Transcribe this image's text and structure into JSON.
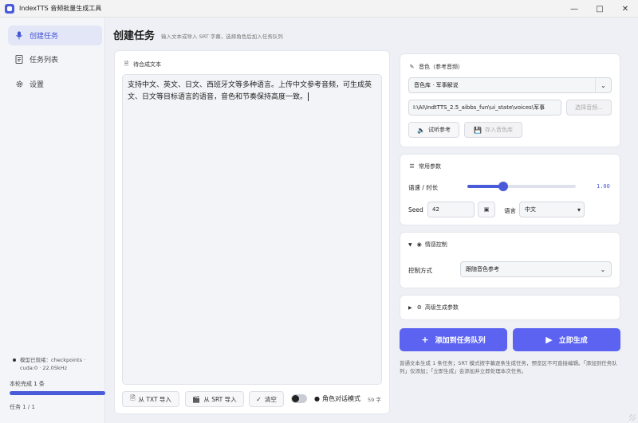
{
  "window": {
    "title": "IndexTTS 音频批量生成工具",
    "controls": [
      "minimize",
      "maximize",
      "close"
    ]
  },
  "sidebar": {
    "items": [
      {
        "label": "创建任务",
        "icon": "microphone-icon",
        "active": true
      },
      {
        "label": "任务列表",
        "icon": "list-icon",
        "active": false
      },
      {
        "label": "设置",
        "icon": "gear-icon",
        "active": false
      }
    ],
    "model_status": "模型已就绪：checkpoints · cuda:0 · 22.05kHz",
    "progress_label": "本轮完成 1 条",
    "progress_fraction": 1.0,
    "task_counter": "任务 1 / 1"
  },
  "header": {
    "title": "创建任务",
    "subtitle": "输入文本或导入 SRT 字幕，选择角色后加入任务队列"
  },
  "text_panel": {
    "title": "待合成文本",
    "content": "支持中文、英文、日文、西班牙文等多种语言。上传中文参考音频，可生成英文、日文等目标语言的语音，音色和节奏保持高度一致。",
    "import_txt_label": "从 TXT 导入",
    "import_srt_label": "从 SRT 导入",
    "clear_label": "清空",
    "role_dialog_label": "角色对话模式",
    "role_dialog_enabled": false,
    "char_count": "59 字"
  },
  "voice_panel": {
    "title": "音色（参考音频）",
    "voice_select": "音色库 · 军事解说",
    "ref_path": "I:\\AI\\IndtTTS_2.5_aibbs_fun\\ui_state\\voices\\军事",
    "choose_audio_label": "选择音频...",
    "preview_label": "试听参考",
    "save_label": "存入音色库"
  },
  "params_panel": {
    "title": "常用参数",
    "speed_label": "语速 / 时长",
    "speed_value": "1.00",
    "speed_slider_fraction": 0.33,
    "seed_label": "Seed",
    "seed_value": "42",
    "lang_label": "语言",
    "lang_value": "中文"
  },
  "emotion_panel": {
    "title": "情感控制",
    "mode_label": "控制方式",
    "mode_value": "跟随音色参考"
  },
  "advanced_panel": {
    "title": "高级生成参数"
  },
  "actions": {
    "add_queue_label": "添加到任务队列",
    "generate_label": "立即生成",
    "hint": "普通文本生成 1 条任务；SRT 模式按字幕逐条生成任务，预览区不可直接编辑。「添加到任务队列」仅添加；「立即生成」会添加并立即处理本次任务。"
  },
  "colors": {
    "accent": "#4a5bd9",
    "primary_button": "#5b63f0",
    "sidebar_bg": "#f4f5f8"
  }
}
